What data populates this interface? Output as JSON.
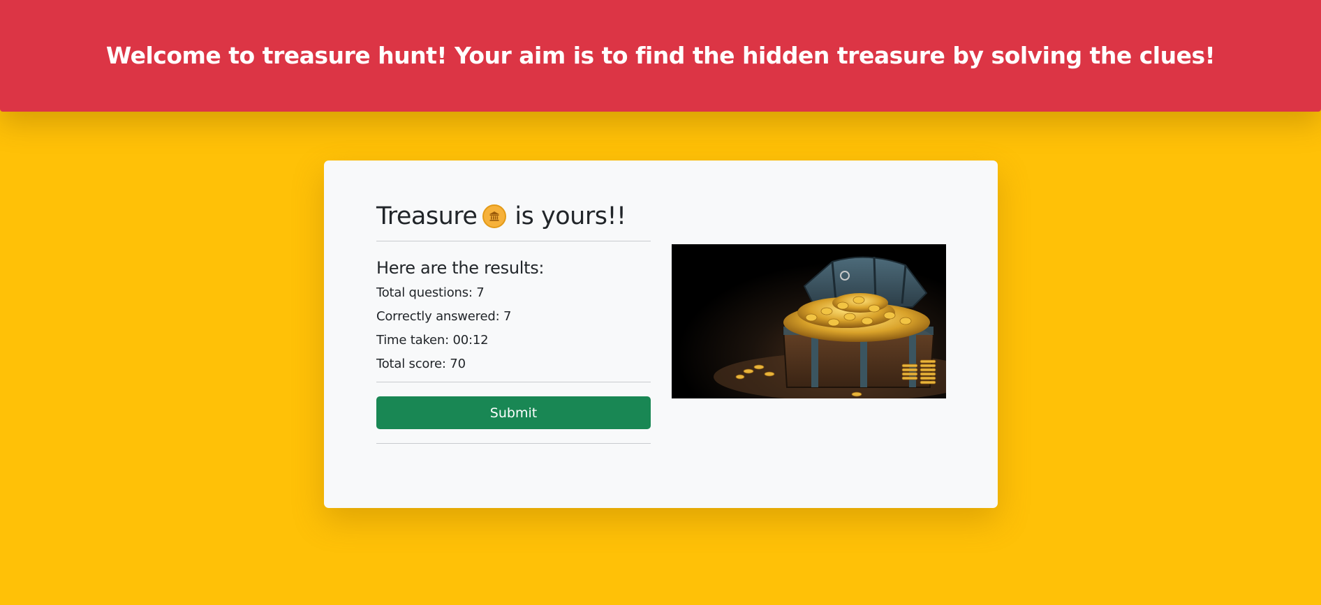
{
  "header": {
    "banner_text": "Welcome to treasure hunt! Your aim is to find the hidden treasure by solving the clues!"
  },
  "card": {
    "title_prefix": "Treasure",
    "title_icon": "coin-icon",
    "title_suffix": "is yours!!",
    "results_heading": "Here are the results:",
    "stats": [
      {
        "label": "Total questions: 7"
      },
      {
        "label": "Correctly answered: 7"
      },
      {
        "label": "Time taken: 00:12"
      },
      {
        "label": "Total score: 70"
      }
    ],
    "submit_label": "Submit",
    "image": "treasure-chest-image"
  },
  "colors": {
    "background": "#ffc107",
    "banner": "#dc3545",
    "card": "#f8f9fa",
    "button": "#198754",
    "coin": "#f6b13a"
  }
}
